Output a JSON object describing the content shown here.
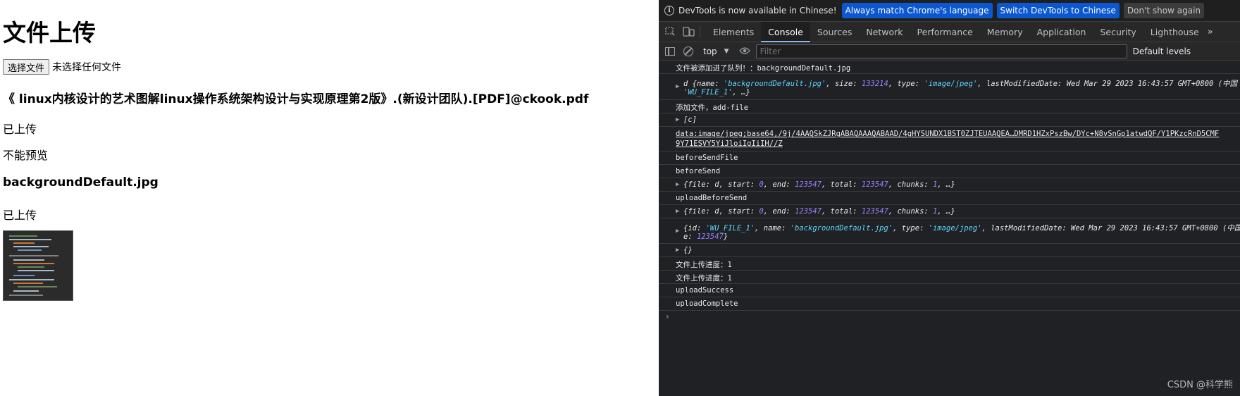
{
  "page": {
    "title": "文件上传",
    "choose_file_button": "选择文件",
    "no_file_text": "未选择任何文件",
    "file1_name": "《 linux内核设计的艺术图解linux操作系统架构设计与实现原理第2版》.(新设计团队).[PDF]@ckook.pdf",
    "file1_status": "已上传",
    "file1_preview": "不能预览",
    "file2_name": "backgroundDefault.jpg",
    "file2_status": "已上传"
  },
  "devtools": {
    "infobar": {
      "message": "DevTools is now available in Chinese!",
      "btn_match": "Always match Chrome's language",
      "btn_switch": "Switch DevTools to Chinese",
      "btn_dismiss": "Don't show again"
    },
    "tabs": [
      "Elements",
      "Console",
      "Sources",
      "Network",
      "Performance",
      "Memory",
      "Application",
      "Security",
      "Lighthouse"
    ],
    "more": "»",
    "context": "top",
    "filter_placeholder": "Filter",
    "levels": "Default levels",
    "console": {
      "l1": "文件被添加进了队列！：backgroundDefault.jpg",
      "l2_prefix": "d {",
      "l2_a": "name: ",
      "l2_av": "'backgroundDefault.jpg'",
      "l2_b": ", size: ",
      "l2_bv": "133214",
      "l2_c": ", type: ",
      "l2_cv": "'image/jpeg'",
      "l2_d": ", lastModifiedDate: Wed Mar 29 2023 16:43:57 GMT+0800 (中国",
      "l2_line2": "'WU_FILE_1'",
      "l2_line2b": ", …}",
      "l3": "添加文件，add-file",
      "l4": "[c]",
      "l5_line1": "data:image/jpeg;base64,/9j/4AAQSkZJRgABAQAAAQABAAD/4gHYSUNDX1BST0ZJTEUAAQEA…DMRD1HZxPszBw/DYc+N8vSnGp1atwdQF/Y1PKzcRnD5CMF",
      "l5_line2": "9Y71ESVY5YiJloiIgIiIH//Z",
      "l6": "beforeSendFile",
      "l7": "beforeSend",
      "l8_a": "{file: d, start: ",
      "l8_start": "0",
      "l8_b": ", end: ",
      "l8_end": "123547",
      "l8_c": ", total: ",
      "l8_total": "123547",
      "l8_d": ", chunks: ",
      "l8_chunks": "1",
      "l8_e": ", …}",
      "l9": "uploadBeforeSend",
      "l10_a": "{file: d, start: ",
      "l10_start": "0",
      "l10_b": ", end: ",
      "l10_end": "123547",
      "l10_c": ", total: ",
      "l10_total": "123547",
      "l10_d": ", chunks: ",
      "l10_chunks": "1",
      "l10_e": ", …}",
      "l11_a": "{id: ",
      "l11_id": "'WU_FILE_1'",
      "l11_b": ", name: ",
      "l11_name": "'backgroundDefault.jpg'",
      "l11_c": ", type: ",
      "l11_type": "'image/jpeg'",
      "l11_d": ", lastModifiedDate: Wed Mar 29 2023 16:43:57 GMT+0800 (中国",
      "l11_line2a": "e: ",
      "l11_line2v": "123547",
      "l11_line2b": "}",
      "l12": "{}",
      "l13": "文件上传进度：1",
      "l14": "文件上传进度：1",
      "l15": "uploadSuccess",
      "l16": "uploadComplete",
      "prompt": "›"
    }
  },
  "watermark": "CSDN @科学熊",
  "colors": {
    "devtools_bg": "#202124",
    "tab_active_underline": "#8ab4f8",
    "string": "#5cd5fb",
    "number": "#9980ff",
    "button_blue": "#0b57d0"
  }
}
